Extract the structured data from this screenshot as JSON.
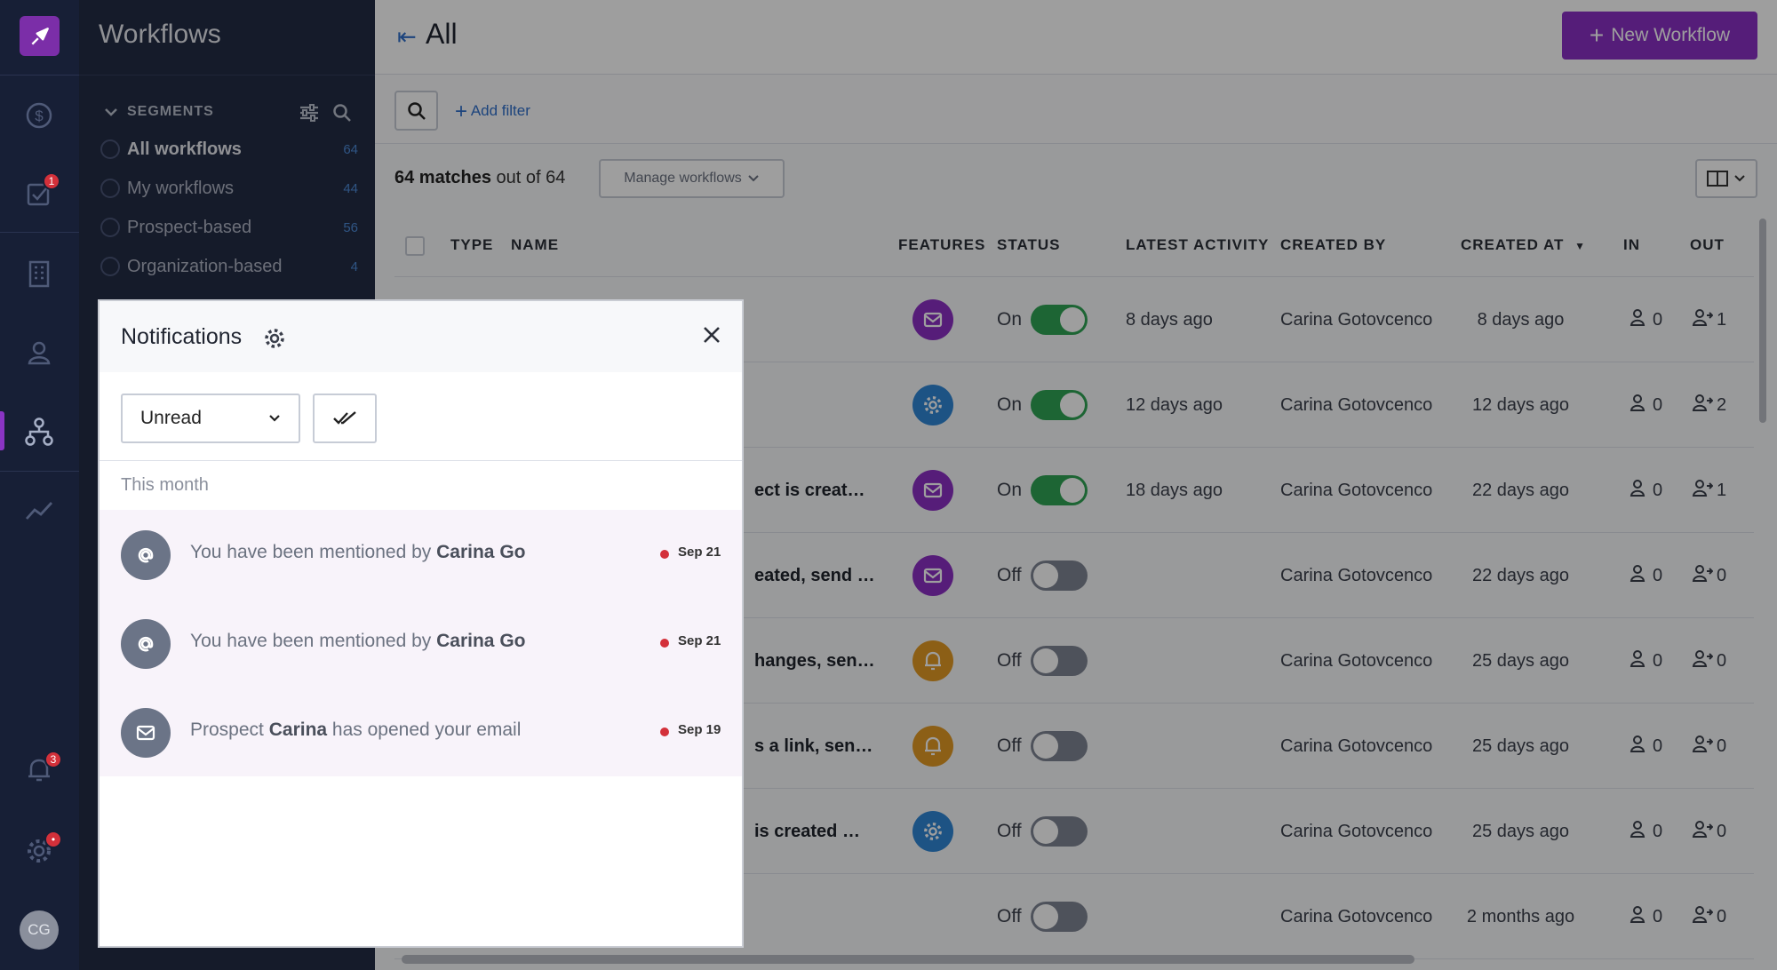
{
  "rail": {
    "avatar_initials": "CG",
    "tasks_badge": "1",
    "notifications_badge": "3",
    "settings_badge": "•"
  },
  "sidebar": {
    "title": "Workflows",
    "segments_header": "SEGMENTS",
    "segments": [
      {
        "label": "All workflows",
        "count": "64",
        "active": true
      },
      {
        "label": "My workflows",
        "count": "44",
        "active": false
      },
      {
        "label": "Prospect-based",
        "count": "56",
        "active": false
      },
      {
        "label": "Organization-based",
        "count": "4",
        "active": false
      }
    ]
  },
  "main": {
    "title": "All",
    "new_button": "New Workflow",
    "add_filter": "Add filter",
    "matches_count": "64 matches",
    "matches_suffix": "out of 64",
    "manage_button": "Manage workflows",
    "columns": {
      "type": "TYPE",
      "name": "NAME",
      "features": "FEATURES",
      "status": "STATUS",
      "latest_activity": "LATEST ACTIVITY",
      "created_by": "CREATED BY",
      "created_at": "CREATED AT",
      "in": "IN",
      "out": "OUT"
    },
    "rows": [
      {
        "name": "",
        "feature": "mail",
        "status": "On",
        "on": true,
        "latest": "8 days ago",
        "by": "Carina Gotovcenco",
        "at": "8 days ago",
        "in": "0",
        "out": "1"
      },
      {
        "name": "",
        "feature": "gear",
        "status": "On",
        "on": true,
        "latest": "12 days ago",
        "by": "Carina Gotovcenco",
        "at": "12 days ago",
        "in": "0",
        "out": "2"
      },
      {
        "name": "ect is creat…",
        "feature": "mail",
        "status": "On",
        "on": true,
        "latest": "18 days ago",
        "by": "Carina Gotovcenco",
        "at": "22 days ago",
        "in": "0",
        "out": "1"
      },
      {
        "name": "eated, send …",
        "feature": "mail",
        "status": "Off",
        "on": false,
        "latest": "",
        "by": "Carina Gotovcenco",
        "at": "22 days ago",
        "in": "0",
        "out": "0"
      },
      {
        "name": "hanges, sen…",
        "feature": "bell",
        "status": "Off",
        "on": false,
        "latest": "",
        "by": "Carina Gotovcenco",
        "at": "25 days ago",
        "in": "0",
        "out": "0"
      },
      {
        "name": "s a link, sen…",
        "feature": "bell",
        "status": "Off",
        "on": false,
        "latest": "",
        "by": "Carina Gotovcenco",
        "at": "25 days ago",
        "in": "0",
        "out": "0"
      },
      {
        "name": "is created …",
        "feature": "gear",
        "status": "Off",
        "on": false,
        "latest": "",
        "by": "Carina Gotovcenco",
        "at": "25 days ago",
        "in": "0",
        "out": "0"
      },
      {
        "name": "",
        "feature": "",
        "status": "Off",
        "on": false,
        "latest": "",
        "by": "Carina Gotovcenco",
        "at": "2 months ago",
        "in": "0",
        "out": "0"
      }
    ]
  },
  "notifications": {
    "title": "Notifications",
    "filter_value": "Unread",
    "section": "This month",
    "items": [
      {
        "icon": "at",
        "pre": "You have been mentioned by ",
        "bold": "Carina Go",
        "post": "",
        "date": "Sep 21"
      },
      {
        "icon": "at",
        "pre": "You have been mentioned by ",
        "bold": "Carina Go",
        "post": "",
        "date": "Sep 21"
      },
      {
        "icon": "mail",
        "pre": "Prospect ",
        "bold": "Carina",
        "post": " has opened your email",
        "date": "Sep 19"
      }
    ]
  },
  "colors": {
    "brand": "#8a2fc4",
    "toggle_on": "#2fa454",
    "feature_purple": "#8c2fc3",
    "feature_blue": "#2f86d6",
    "feature_orange": "#e39a25",
    "unread_dot": "#d3303a"
  }
}
